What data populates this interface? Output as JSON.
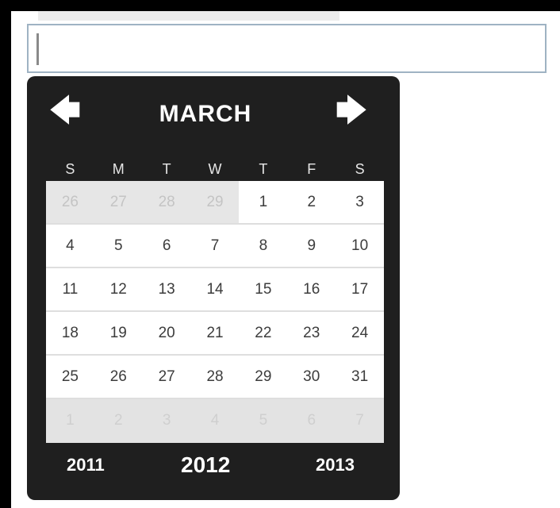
{
  "input": {
    "value": "",
    "placeholder": ""
  },
  "calendar": {
    "month": "MARCH",
    "prev_icon": "arrow-left-icon",
    "next_icon": "arrow-right-icon",
    "weekdays": [
      "S",
      "M",
      "T",
      "W",
      "T",
      "F",
      "S"
    ],
    "weeks": [
      [
        "26",
        "27",
        "28",
        "29",
        "1",
        "2",
        "3"
      ],
      [
        "4",
        "5",
        "6",
        "7",
        "8",
        "9",
        "10"
      ],
      [
        "11",
        "12",
        "13",
        "14",
        "15",
        "16",
        "17"
      ],
      [
        "18",
        "19",
        "20",
        "21",
        "22",
        "23",
        "24"
      ],
      [
        "25",
        "26",
        "27",
        "28",
        "29",
        "30",
        "31"
      ],
      [
        "1",
        "2",
        "3",
        "4",
        "5",
        "6",
        "7"
      ]
    ],
    "years": {
      "prev": "2011",
      "current": "2012",
      "next": "2013"
    }
  },
  "colors": {
    "picker_bg": "#1f1f1f",
    "day_text": "#3c3c3c",
    "muted_day": "#c4c4c4",
    "input_border": "#9fb3c3"
  }
}
